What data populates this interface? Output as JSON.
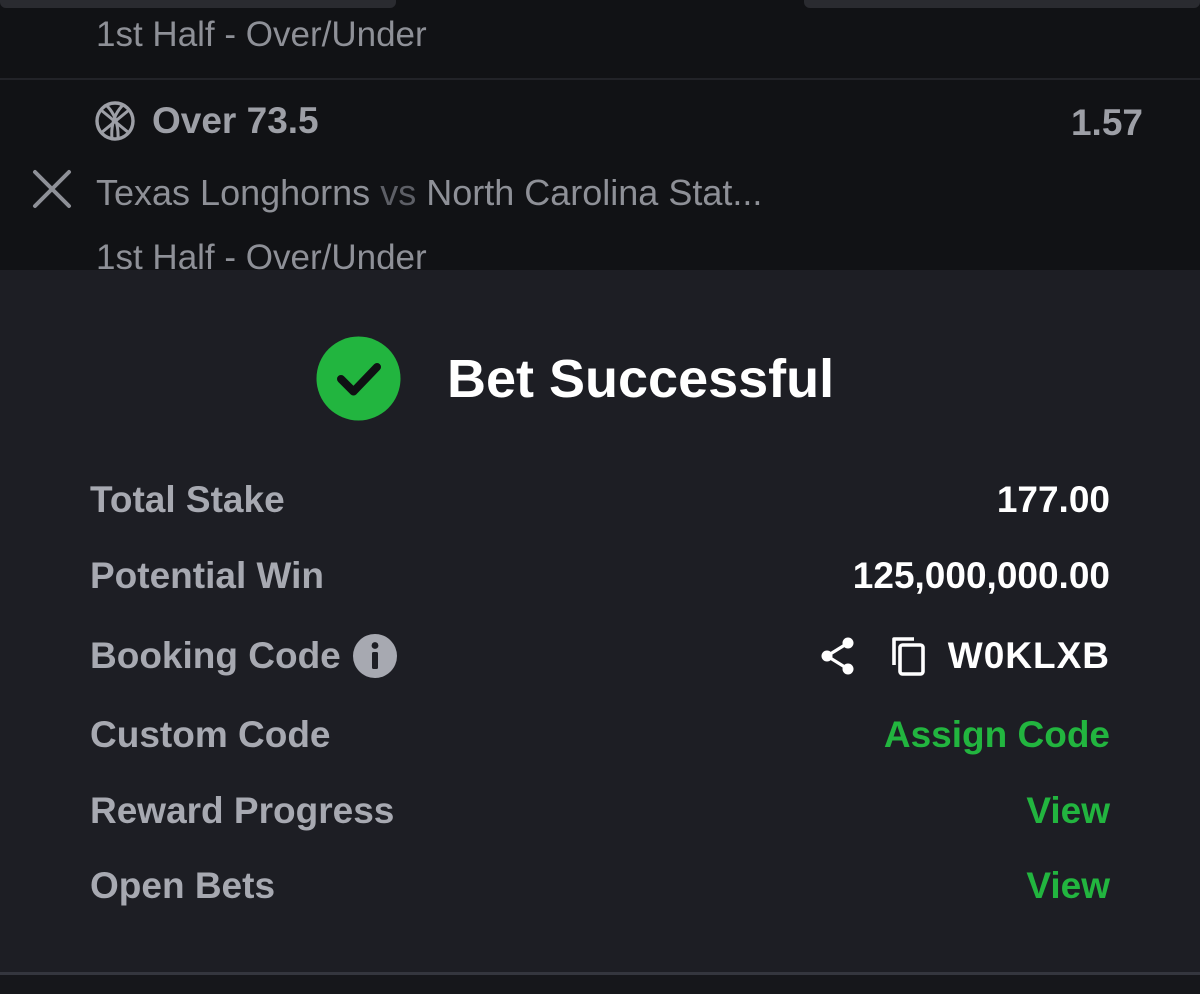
{
  "slip": {
    "previous_market": "1st Half - Over/Under",
    "selection": {
      "icon": "basketball-icon",
      "pick": "Over 73.5",
      "odds": "1.57",
      "home_team": "Texas Longhorns",
      "vs": "vs",
      "away_team": "North Carolina Stat...",
      "market": "1st Half - Over/Under",
      "remove_icon": "close-icon"
    }
  },
  "success": {
    "icon": "checkmark-circle-icon",
    "title": "Bet Successful",
    "rows": {
      "total_stake": {
        "label": "Total Stake",
        "value": "177.00"
      },
      "potential_win": {
        "label": "Potential Win",
        "value": "125,000,000.00"
      },
      "booking_code": {
        "label": "Booking Code",
        "value": "W0KLXB",
        "info_icon": "info-icon",
        "share_icon": "share-icon",
        "copy_icon": "copy-icon"
      },
      "custom_code": {
        "label": "Custom Code",
        "value": "Assign Code"
      },
      "reward_progress": {
        "label": "Reward Progress",
        "value": "View"
      },
      "open_bets": {
        "label": "Open Bets",
        "value": "View"
      }
    }
  },
  "colors": {
    "accent_green": "#22b53f",
    "panel_bg": "#1d1e24",
    "slip_bg": "#111215"
  }
}
